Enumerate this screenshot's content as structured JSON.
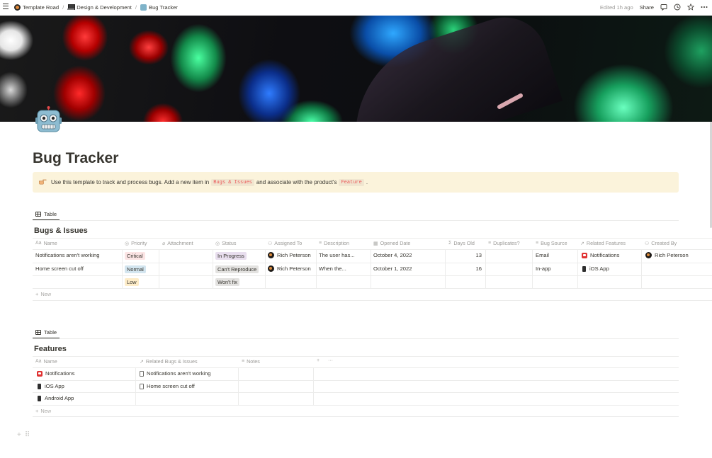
{
  "breadcrumbs": [
    {
      "label": "Template Road",
      "icon": "road-logo-icon"
    },
    {
      "label": "Design & Development",
      "icon": "laptop-icon"
    },
    {
      "label": "Bug Tracker",
      "icon": "robot-icon"
    }
  ],
  "topbar": {
    "edited": "Edited 1h ago",
    "share": "Share"
  },
  "page": {
    "title": "Bug Tracker"
  },
  "callout": {
    "text_before": "Use this template to track and process bugs. Add a new item in",
    "code1": "Bugs & Issues",
    "text_middle": "and associate with the product's",
    "code2": "Feature",
    "text_end": "."
  },
  "bugs_db": {
    "view_tab": "Table",
    "title": "Bugs & Issues",
    "columns": [
      "Name",
      "Priority",
      "Attachment",
      "Status",
      "Assigned To",
      "Description",
      "Opened Date",
      "Days Old",
      "Duplicates?",
      "Bug Source",
      "Related Features",
      "Created By"
    ],
    "rows": [
      {
        "name": "Notifications aren't working",
        "priority": "Critical",
        "status": "In Progress",
        "assigned": "Rich Peterson",
        "description": "The user has...",
        "opened": "October 4, 2022",
        "days_old": "13",
        "source": "Email",
        "feature": "Notifications",
        "created_by": "Rich Peterson"
      },
      {
        "name": "Home screen cut off",
        "priority": "Normal",
        "status": "Can't Reproduce",
        "assigned": "Rich Peterson",
        "description": "When the...",
        "opened": "October 1, 2022",
        "days_old": "16",
        "source": "In-app",
        "feature": "iOS App",
        "created_by": ""
      },
      {
        "name": "",
        "priority": "Low",
        "status": "Won't fix",
        "assigned": "",
        "description": "",
        "opened": "",
        "days_old": "",
        "source": "",
        "feature": "",
        "created_by": ""
      }
    ],
    "new_label": "New"
  },
  "features_db": {
    "view_tab": "Table",
    "title": "Features",
    "columns": [
      "Name",
      "Related Bugs & Issues",
      "Notes"
    ],
    "rows": [
      {
        "name": "Notifications",
        "related": "Notifications aren't working",
        "icon": "notification-icon"
      },
      {
        "name": "iOS App",
        "related": "Home screen cut off",
        "icon": "phone-icon"
      },
      {
        "name": "Android App",
        "related": "",
        "icon": "phone-icon"
      }
    ],
    "new_label": "New"
  },
  "colors": {
    "callout_bg": "#fbf3db",
    "code_text": "#eb5757",
    "critical": "#fbe4e4",
    "normal": "#d3e5ef",
    "low": "#fdecc8",
    "in_progress": "#e8deee"
  }
}
